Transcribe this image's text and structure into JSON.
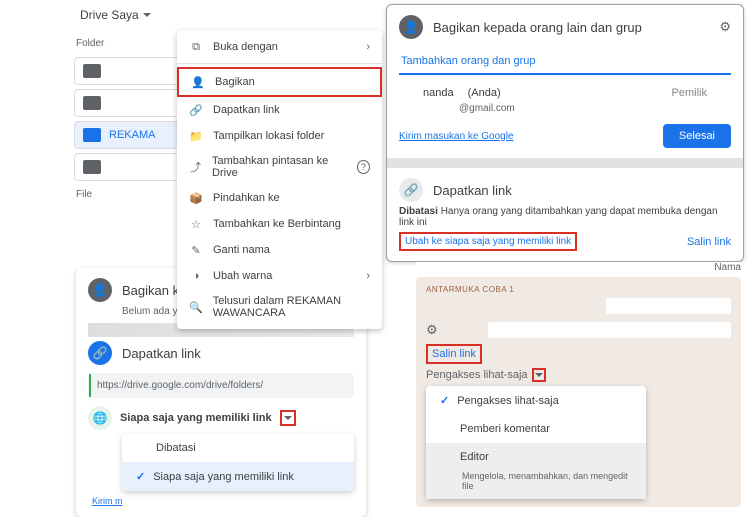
{
  "p1": {
    "drive_label": "Drive Saya",
    "folders_label": "Folder",
    "file_label": "File",
    "folder_selected": "REKAMA",
    "ctx": {
      "open_with": "Buka dengan",
      "share": "Bagikan",
      "get_link": "Dapatkan link",
      "show_loc": "Tampilkan lokasi folder",
      "add_shortcut": "Tambahkan pintasan ke Drive",
      "move": "Pindahkan ke",
      "star": "Tambahkan ke Berbintang",
      "rename": "Ganti nama",
      "color": "Ubah warna",
      "search_in": "Telusuri dalam REKAMAN WAWANCARA"
    }
  },
  "p2": {
    "title": "Bagikan kepada orang lain dan grup",
    "placeholder": "Tambahkan orang dan grup",
    "user": "nanda",
    "you": "(Anda)",
    "email": "@gmail.com",
    "owner": "Pemilik",
    "feedback": "Kirim masukan ke Google",
    "done": "Selesai",
    "link_title": "Dapatkan link",
    "restricted_b": "Dibatasi",
    "restricted": "Hanya orang yang ditambahkan yang dapat membuka dengan link ini",
    "change": "Ubah ke siapa saja yang memiliki link",
    "copy": "Salin link"
  },
  "p3": {
    "title": "Bagikan kepada orang lain dan gr",
    "none": "Belum ada yang ditambahkan",
    "link_title": "Dapatkan link",
    "url": "https://drive.google.com/drive/folders/",
    "scope": "Siapa saja yang memiliki link",
    "opt_restricted": "Dibatasi",
    "opt_anyone": "Siapa saja yang memiliki link",
    "kirim": "Kirim m"
  },
  "p4": {
    "nama": "Nama",
    "antarmuka": "ANTARMUKA COBA 1",
    "copy": "Salin link",
    "perm_label": "Pengakses lihat-saja",
    "opt_viewer": "Pengakses lihat-saja",
    "opt_commenter": "Pemberi komentar",
    "opt_editor": "Editor",
    "editor_desc": "Mengelola, menambahkan, dan mengedit file"
  }
}
